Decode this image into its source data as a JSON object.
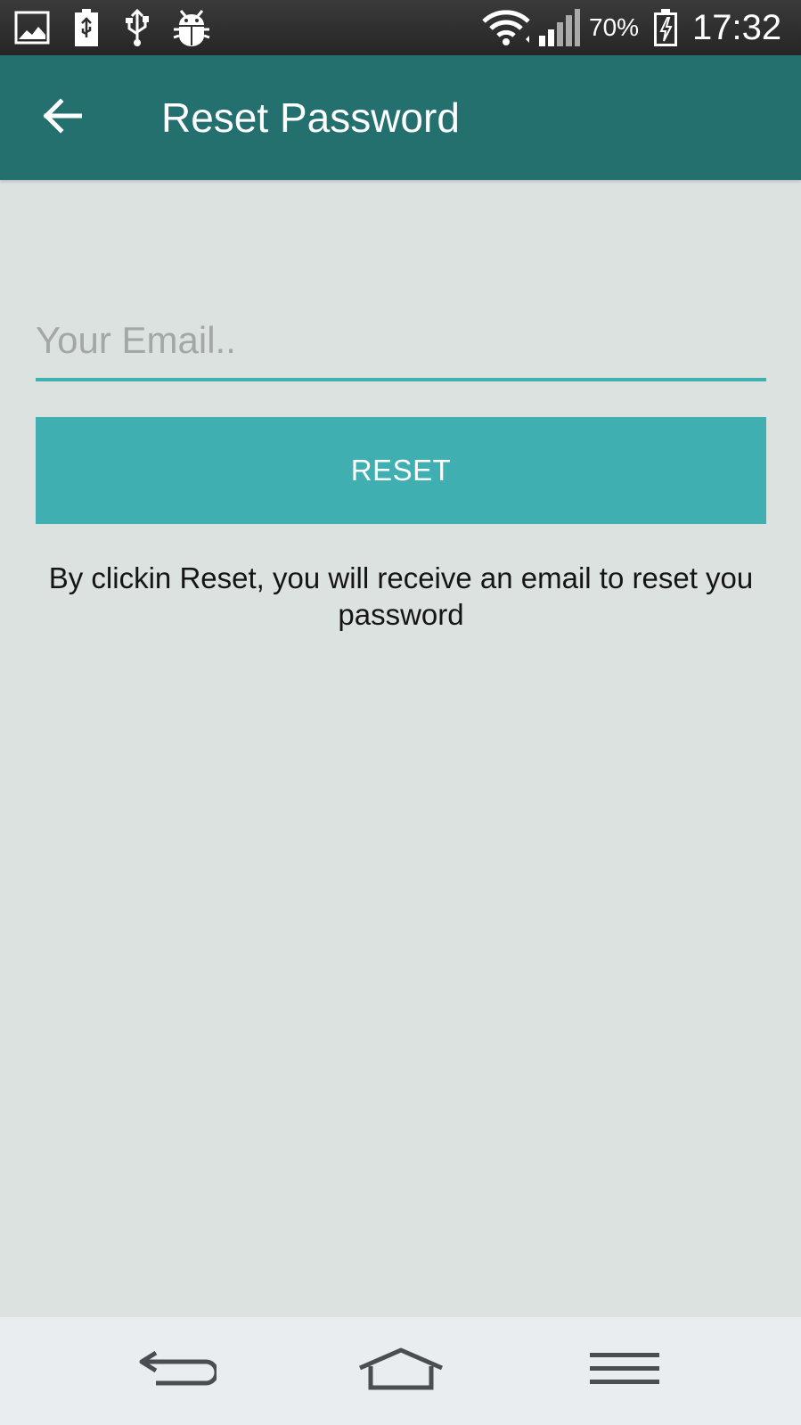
{
  "status_bar": {
    "battery_percent": "70%",
    "time": "17:32",
    "icons": [
      "gallery-icon",
      "battery-icon",
      "usb-icon",
      "debug-icon",
      "wifi-icon",
      "signal-icon",
      "charging-icon"
    ]
  },
  "app_bar": {
    "back_icon": "arrow-left-icon",
    "title": "Reset Password"
  },
  "form": {
    "email_value": "",
    "email_placeholder": "Your Email..",
    "reset_label": "RESET",
    "helper_text": "By clickin Reset, you will receive an email to reset you password"
  },
  "nav_bar": {
    "icons": [
      "back-icon",
      "home-icon",
      "menu-icon"
    ]
  },
  "colors": {
    "app_bar": "#23706f",
    "accent": "#40afb1",
    "background": "#dbe2df",
    "nav_bar": "#e9edf0"
  }
}
